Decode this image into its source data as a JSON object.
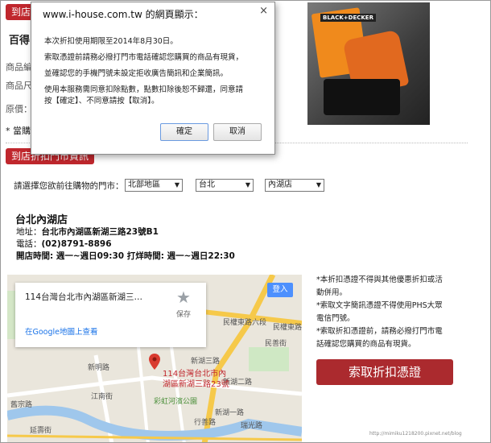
{
  "dialog": {
    "title": "www.i-house.com.tw 的網頁顯示：",
    "close": "×",
    "lines": [
      "本次折扣使用期限至2014年8月30日。",
      "索取憑證前請務必撥打門市電話確認您購買的商品有現貨，",
      "並確認您的手機門號未設定拒收廣告簡訊和企業簡訊。",
      "使用本服務需同意扣除點數，點數扣除後恕不歸還，同意請",
      "按【確定】、不同意請按【取消】。"
    ],
    "ok": "確定",
    "cancel": "取消"
  },
  "behind": {
    "tab1": "到店",
    "title": "百得",
    "row1": "商品編",
    "row2": "商品尺",
    "row3": "原價：",
    "row4": "* 當購"
  },
  "tab2": "到店折扣門市資訊",
  "select_prompt": "請選擇您欲前往購物的門市：",
  "selects": [
    "北部地區",
    "台北",
    "內湖店"
  ],
  "store": {
    "name": "台北內湖店",
    "addr_label": "地址：",
    "addr": "台北市內湖區新湖三路23號B1",
    "tel_label": "電話：",
    "tel": "(02)8791-8896",
    "hours": "開店時間: 週一~週日09:30 打烊時間: 週一~週日22:30"
  },
  "map": {
    "card_addr": "114台灣台北市內湖區新湖三…",
    "save": "保存",
    "link": "在Google地圖上查看",
    "login": "登入",
    "pin_label_1": "114台灣台北市內",
    "pin_label_2": "湖區新湖三路23號",
    "places": [
      "民權東路六段",
      "新湖三路",
      "新湖二路",
      "民善街",
      "新明路",
      "彩虹河濱公園",
      "行善路",
      "新湖一路",
      "江南街",
      "延壽街",
      "瑞光路",
      "舊宗路",
      "民權東路"
    ]
  },
  "notes": [
    "*本折扣憑證不得與其他優惠折扣或活",
    "動併用。",
    "*索取文字簡訊憑證不得使用PHS大眾",
    "電信門號。",
    "*索取折扣憑證前，請務必撥打門市電",
    "話確認您購買的商品有現貨。"
  ],
  "cta": "索取折扣憑證",
  "watermark": "http://mimiku1218200.pixnet.net/blog",
  "colors": {
    "accent": "#c0272d",
    "button": "#ab2a2e",
    "map_bg": "#eae6dc",
    "road_yellow": "#f6c94a"
  }
}
